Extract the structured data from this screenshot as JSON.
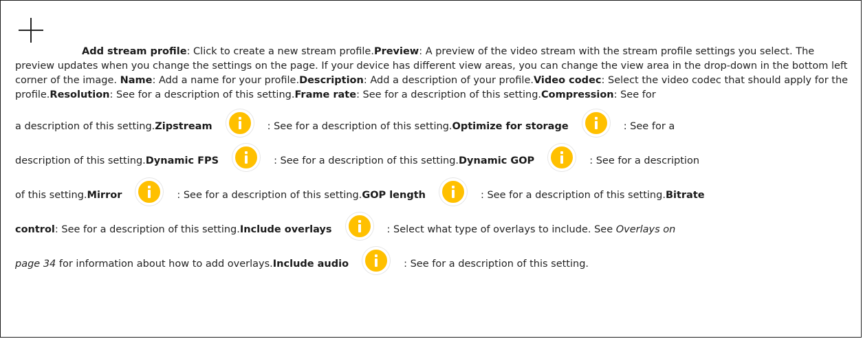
{
  "lead": {
    "add_stream_profile_label": "Add stream profile",
    "add_stream_profile_desc": ": Click to create a new stream profile.",
    "preview_label": "Preview",
    "preview_desc": ": A preview of the video stream with the stream profile settings you select. The preview updates when you change the settings on the page. If your device has different view areas, you can change the view area in the drop-down in the bottom left corner of the image.",
    "name_label": "Name",
    "name_desc": ": Add a name for your profile.",
    "description_label": "Description",
    "description_desc": ": Add a description of your profile.",
    "video_codec_label": "Video codec",
    "video_codec_desc": ": Select the video codec that should apply for the profile.",
    "resolution_label": "Resolution",
    "resolution_desc": ": See for a description of this setting.",
    "frame_rate_label": "Frame rate",
    "frame_rate_desc": ": See for a description of this setting.",
    "compression_label": "Compression",
    "compression_desc": ": See for"
  },
  "rows": {
    "r1_pre": "a description of this setting.",
    "zipstream_label": "Zipstream",
    "zipstream_desc": ": See for a description of this setting.",
    "optimize_label": "Optimize for storage",
    "optimize_desc": ": See for a",
    "r2_pre": "description of this setting.",
    "dynamic_fps_label": "Dynamic FPS",
    "dynamic_fps_desc": ": See for a description of this setting.",
    "dynamic_gop_label": "Dynamic GOP",
    "dynamic_gop_desc": ": See for a description",
    "r3_pre": "of this setting.",
    "mirror_label": "Mirror",
    "mirror_desc": ": See for a description of this setting.",
    "gop_length_label": "GOP length",
    "gop_length_desc": ": See for a description of this setting.",
    "bitrate_label": "Bitrate",
    "bitrate_label_cont": "control",
    "bitrate_desc": ": See for a description of this setting.",
    "include_overlays_label": "Include overlays",
    "include_overlays_desc": ": Select what type of overlays to include. See ",
    "overlays_link_1": "Overlays on",
    "overlays_link_2": "page 34",
    "overlays_tail": " for information about how to add overlays.",
    "include_audio_label": "Include audio",
    "include_audio_desc": ": See for a description of this setting."
  }
}
